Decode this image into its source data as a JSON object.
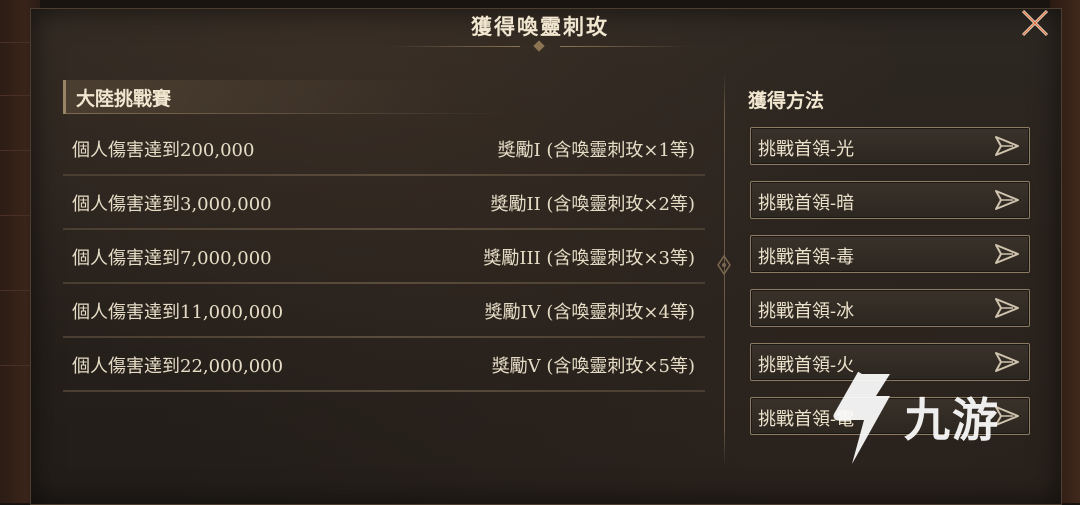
{
  "dialog": {
    "title": "獲得喚靈刺玫"
  },
  "section": {
    "title": "大陸挑戰賽"
  },
  "rows": [
    {
      "condition": "個人傷害達到200,000",
      "reward": "獎勵I (含喚靈刺玫×1等)"
    },
    {
      "condition": "個人傷害達到3,000,000",
      "reward": "獎勵II (含喚靈刺玫×2等)"
    },
    {
      "condition": "個人傷害達到7,000,000",
      "reward": "獎勵III (含喚靈刺玫×3等)"
    },
    {
      "condition": "個人傷害達到11,000,000",
      "reward": "獎勵IV (含喚靈刺玫×4等)"
    },
    {
      "condition": "個人傷害達到22,000,000",
      "reward": "獎勵V (含喚靈刺玫×5等)"
    }
  ],
  "methods": {
    "title": "獲得方法",
    "items": [
      {
        "label": "挑戰首領-光"
      },
      {
        "label": "挑戰首領-暗"
      },
      {
        "label": "挑戰首領-毒"
      },
      {
        "label": "挑戰首領-冰"
      },
      {
        "label": "挑戰首領-火"
      },
      {
        "label": "挑戰首領-電"
      }
    ]
  },
  "watermark": {
    "text": "九游",
    "icon": "jiuyou-logo-icon"
  },
  "icons": {
    "close": "close-icon",
    "go": "arrow-right-icon"
  },
  "colors": {
    "panel_bg": "#27211c",
    "text": "#e6dcc6",
    "border": "#8c7a62",
    "close_accent": "#e0673a"
  }
}
